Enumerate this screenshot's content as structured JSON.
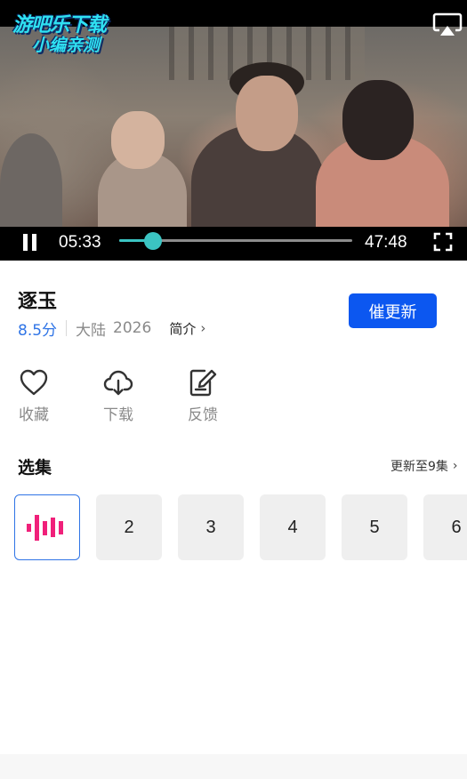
{
  "player": {
    "watermark_line1": "游吧乐下载",
    "watermark_line2": "小编亲测",
    "current_time": "05:33",
    "total_time": "47:48",
    "progress": 0.146,
    "accent_color": "#3bc4c2",
    "icons": [
      "airplay-icon",
      "pause-icon",
      "fullscreen-icon"
    ]
  },
  "show": {
    "title": "逐玉",
    "score": "8.5分",
    "region": "大陆",
    "year": "2026",
    "intro_label": "简介",
    "update_button": "催更新"
  },
  "actions": [
    {
      "label": "收藏",
      "icon": "heart-icon"
    },
    {
      "label": "下载",
      "icon": "cloud-download-icon"
    },
    {
      "label": "反馈",
      "icon": "feedback-edit-icon"
    }
  ],
  "episodes": {
    "title": "选集",
    "update_status": "更新至9集",
    "items": [
      "2",
      "3",
      "4",
      "5",
      "6"
    ],
    "playing_icon": "equalizer-icon",
    "active_color": "#2f74e6",
    "playing_color": "#f0207a"
  }
}
